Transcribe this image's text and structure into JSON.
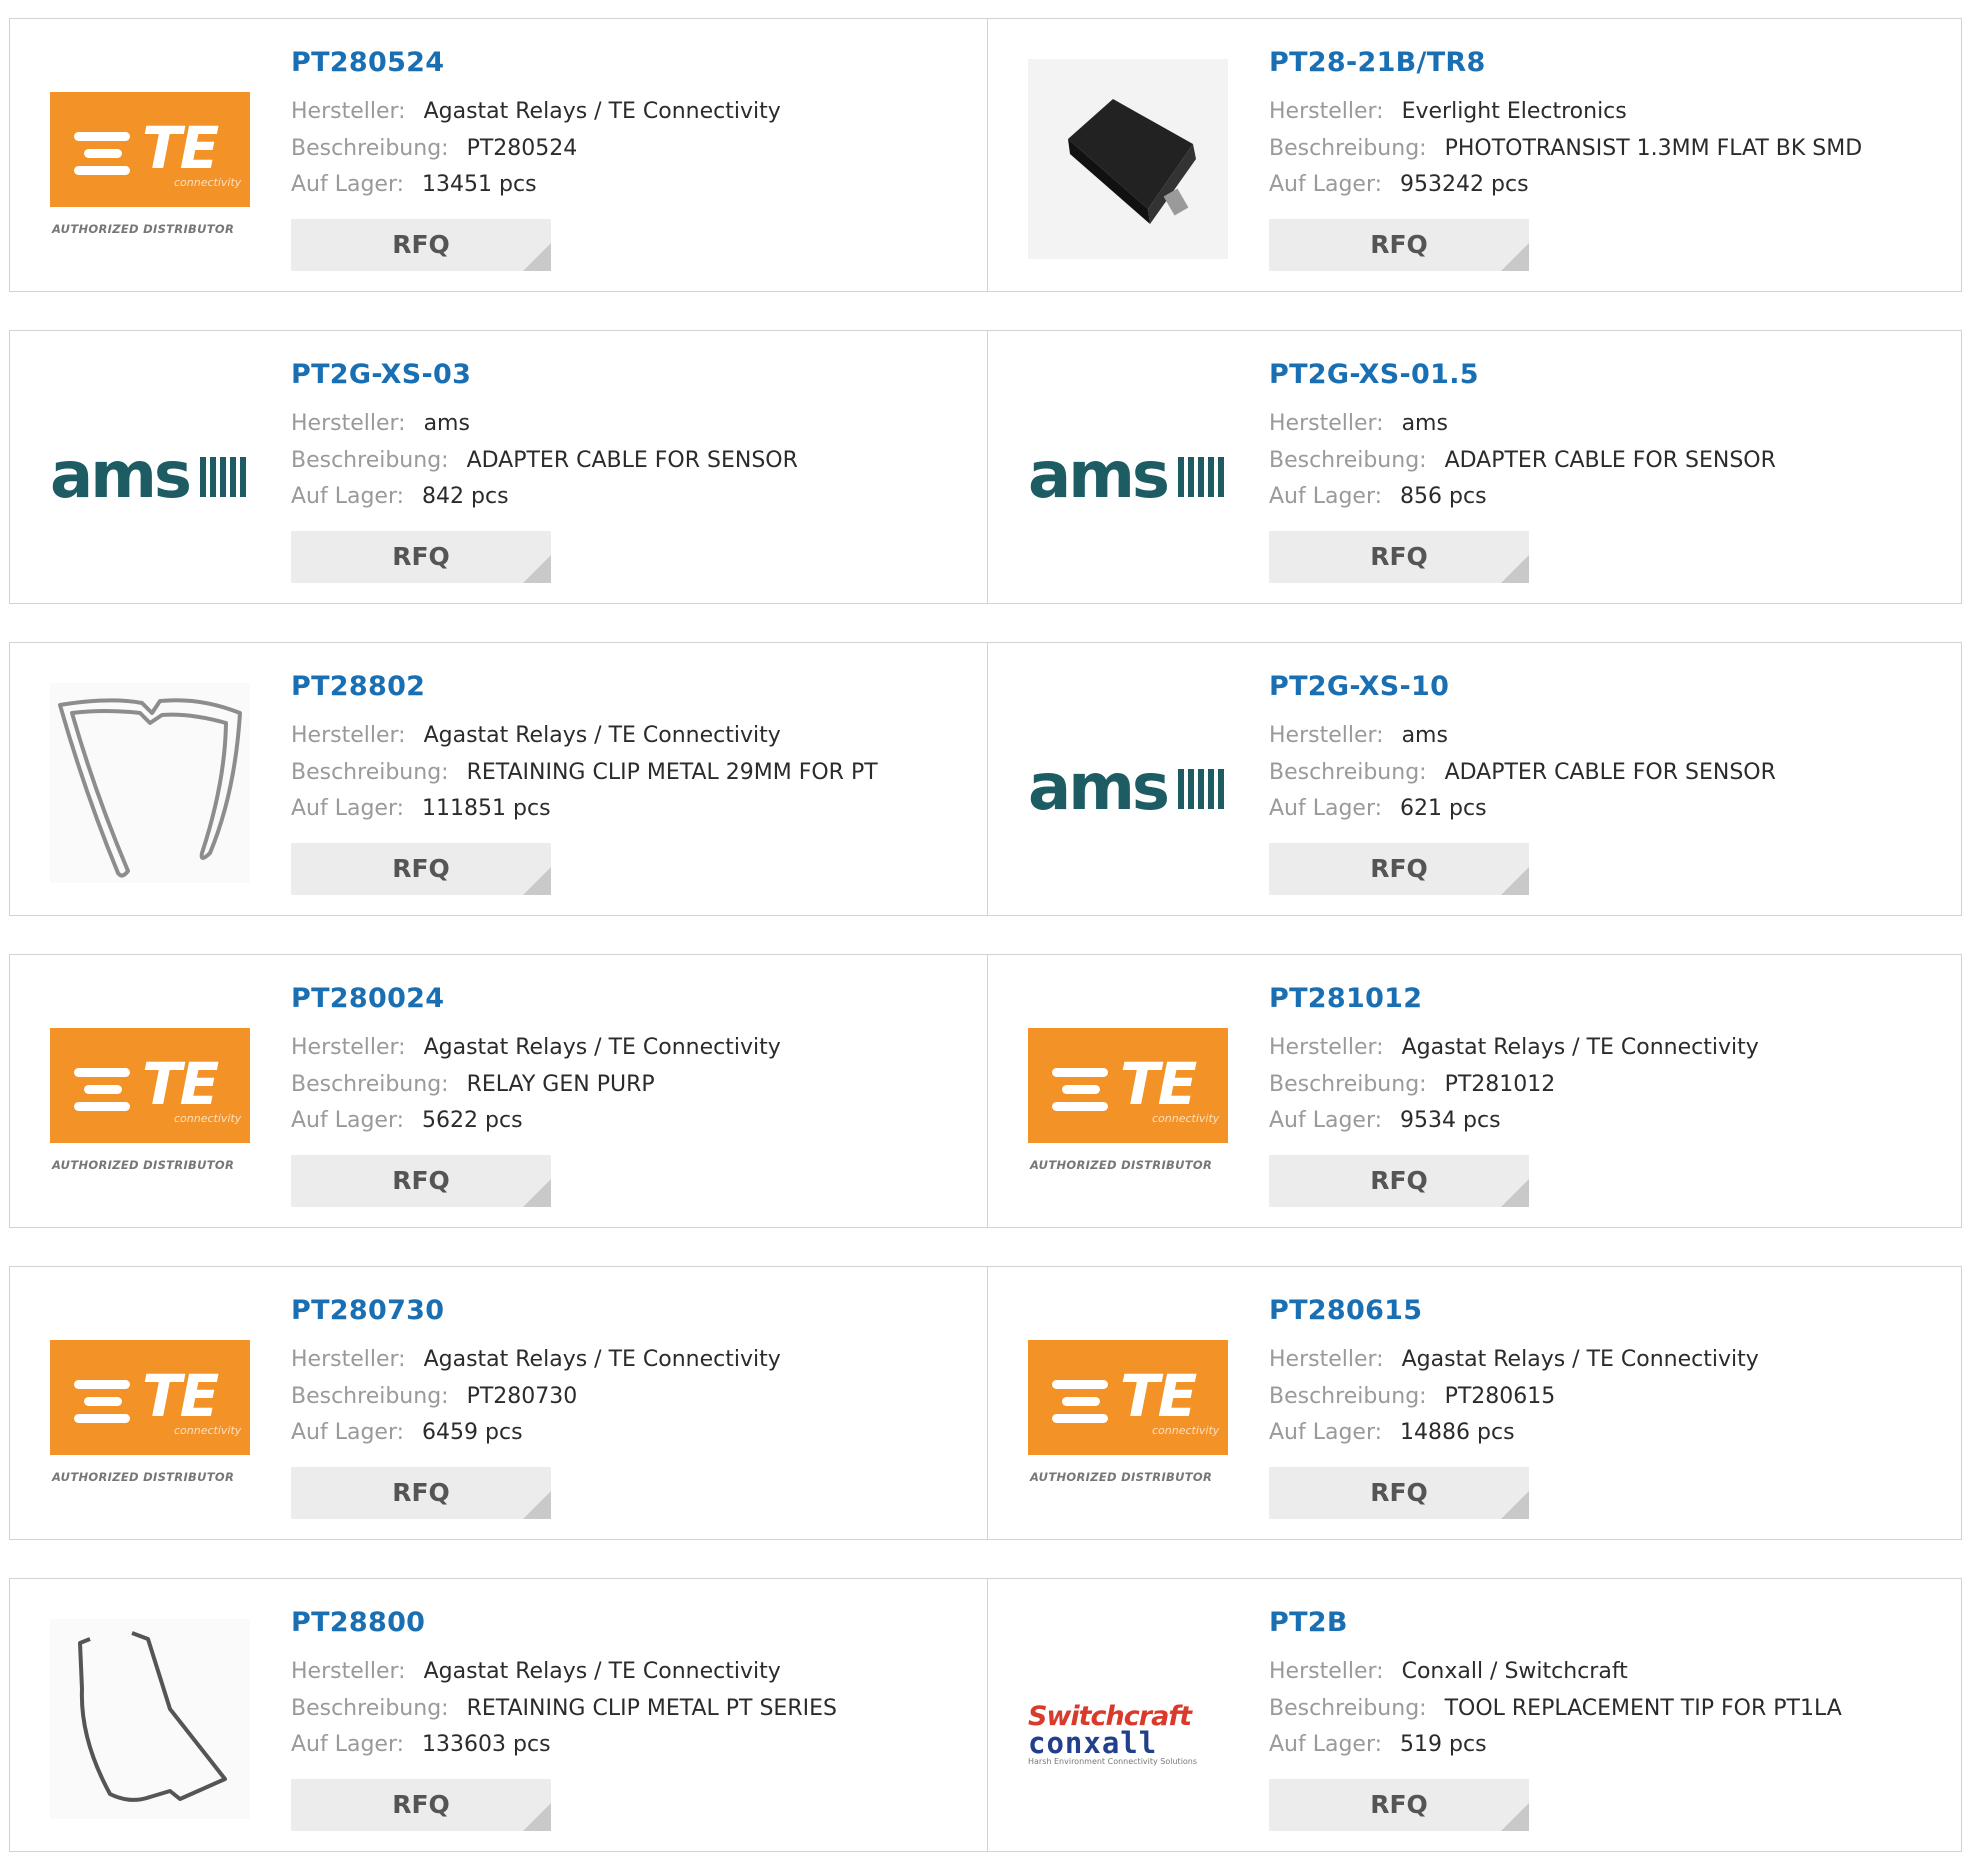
{
  "labels": {
    "manufacturer": "Hersteller:",
    "description": "Beschreibung:",
    "stock": "Auf Lager:",
    "rfq": "RFQ"
  },
  "logo_text": {
    "te_mark": "TE",
    "te_connectivity": "connectivity",
    "te_authorized": "AUTHORIZED DISTRIBUTOR",
    "ams": "ams",
    "switchcraft": "Switchcraft",
    "conxall": "conxall",
    "conxall_tagline": "Harsh Environment Connectivity Solutions"
  },
  "colors": {
    "link": "#1a6fb3",
    "te_orange": "#f39227",
    "ams_teal": "#1e5c63",
    "border": "#d2d2d2"
  },
  "products": [
    {
      "pn": "PT280524",
      "manufacturer": "Agastat Relays / TE Connectivity",
      "description": "PT280524",
      "stock": "13451 pcs",
      "logo": "te-logo"
    },
    {
      "pn": "PT28-21B/TR8",
      "manufacturer": "Everlight Electronics",
      "description": "PHOTOTRANSIST 1.3MM FLAT BK SMD",
      "stock": "953242 pcs",
      "logo": "smd-photo"
    },
    {
      "pn": "PT2G-XS-03",
      "manufacturer": "ams",
      "description": "ADAPTER CABLE FOR SENSOR",
      "stock": "842 pcs",
      "logo": "ams-logo"
    },
    {
      "pn": "PT2G-XS-01.5",
      "manufacturer": "ams",
      "description": "ADAPTER CABLE FOR SENSOR",
      "stock": "856 pcs",
      "logo": "ams-logo"
    },
    {
      "pn": "PT28802",
      "manufacturer": "Agastat Relays / TE Connectivity",
      "description": "RETAINING CLIP METAL 29MM FOR PT",
      "stock": "111851 pcs",
      "logo": "clip-a"
    },
    {
      "pn": "PT2G-XS-10",
      "manufacturer": "ams",
      "description": "ADAPTER CABLE FOR SENSOR",
      "stock": "621 pcs",
      "logo": "ams-logo"
    },
    {
      "pn": "PT280024",
      "manufacturer": "Agastat Relays / TE Connectivity",
      "description": "RELAY GEN PURP",
      "stock": "5622 pcs",
      "logo": "te-logo"
    },
    {
      "pn": "PT281012",
      "manufacturer": "Agastat Relays / TE Connectivity",
      "description": "PT281012",
      "stock": "9534 pcs",
      "logo": "te-logo"
    },
    {
      "pn": "PT280730",
      "manufacturer": "Agastat Relays / TE Connectivity",
      "description": "PT280730",
      "stock": "6459 pcs",
      "logo": "te-logo"
    },
    {
      "pn": "PT280615",
      "manufacturer": "Agastat Relays / TE Connectivity",
      "description": "PT280615",
      "stock": "14886 pcs",
      "logo": "te-logo"
    },
    {
      "pn": "PT28800",
      "manufacturer": "Agastat Relays / TE Connectivity",
      "description": "RETAINING CLIP METAL PT SERIES",
      "stock": "133603 pcs",
      "logo": "clip-b"
    },
    {
      "pn": "PT2B",
      "manufacturer": "Conxall / Switchcraft",
      "description": "TOOL REPLACEMENT TIP FOR PT1LA",
      "stock": "519 pcs",
      "logo": "switchcraft-logo"
    }
  ]
}
